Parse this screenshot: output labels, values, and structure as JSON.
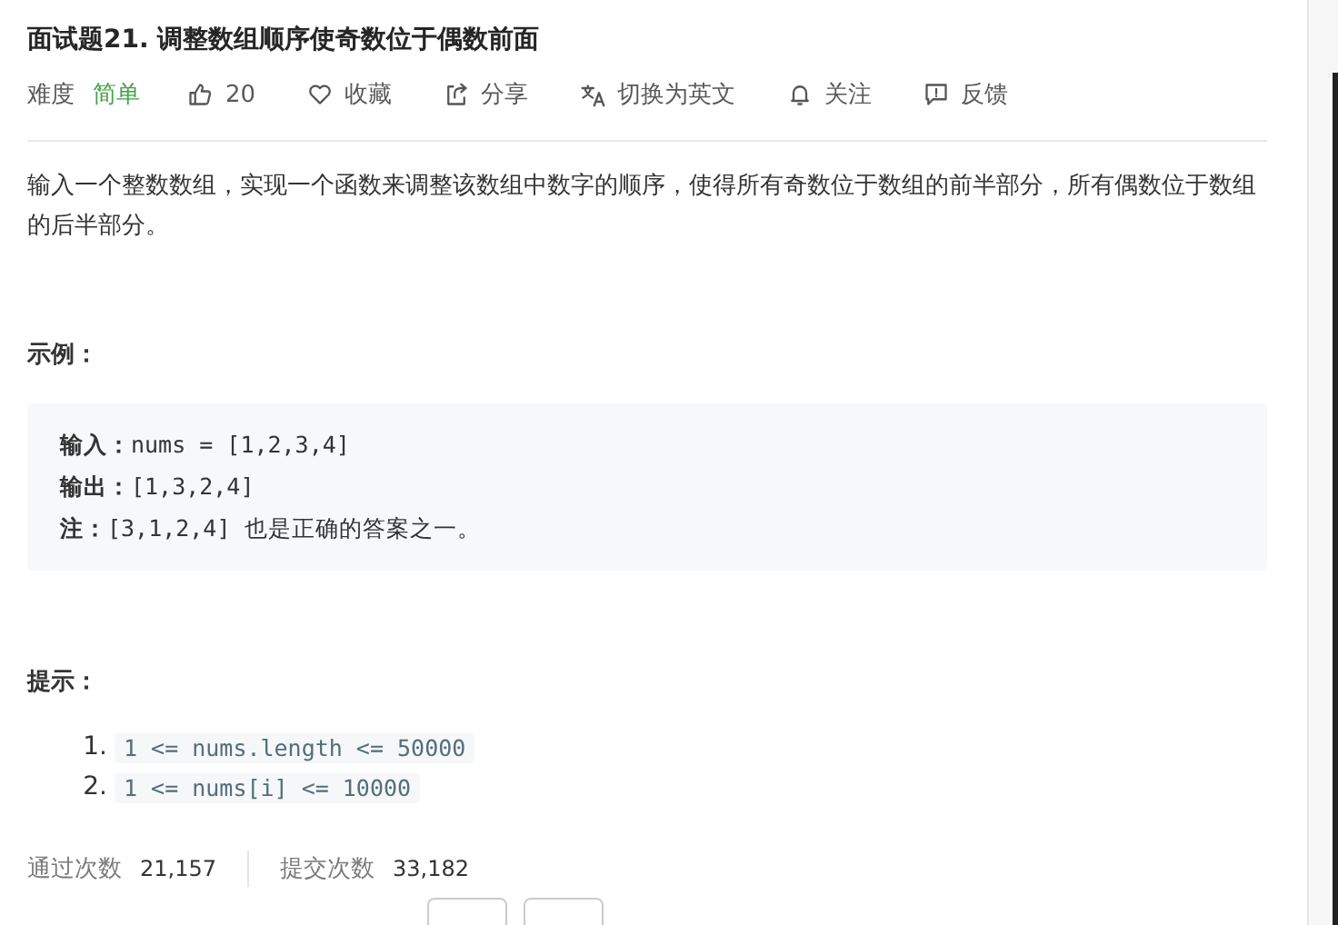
{
  "title": "面试题21. 调整数组顺序使奇数位于偶数前面",
  "meta": {
    "difficulty_label": "难度",
    "difficulty": "简单",
    "actions": [
      {
        "kind": "like",
        "label": "20"
      },
      {
        "kind": "favorite",
        "label": "收藏"
      },
      {
        "kind": "share",
        "label": "分享"
      },
      {
        "kind": "translate",
        "label": "切换为英文"
      },
      {
        "kind": "follow",
        "label": "关注"
      },
      {
        "kind": "feedback",
        "label": "反馈"
      }
    ]
  },
  "description": "输入一个整数数组，实现一个函数来调整该数组中数字的顺序，使得所有奇数位于数组的前半部分，所有偶数位于数组的后半部分。",
  "example_heading": "示例：",
  "example_lines": [
    "**输入：**nums = [1,2,3,4]",
    "**输出：**[1,3,2,4]",
    "**注：**[3,1,2,4] 也是正确的答案之一。"
  ],
  "hints_heading": "提示：",
  "hints": [
    {
      "number": "1.",
      "code": "1 <= nums.length <= 50000"
    },
    {
      "number": "2.",
      "code": "1 <= nums[i] <= 10000"
    }
  ],
  "stats": [
    {
      "label": "通过次数",
      "value": "21,157"
    },
    {
      "label": "提交次数",
      "value": "33,182"
    }
  ],
  "footer_buttons": [
    {
      "kind": "button"
    },
    {
      "kind": "button"
    }
  ]
}
